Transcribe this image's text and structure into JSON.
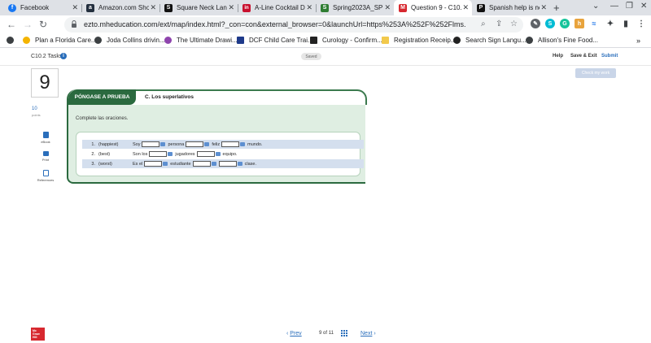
{
  "browser": {
    "tabs": [
      {
        "title": "Facebook",
        "icon": "facebook-icon",
        "color": "#1877f2",
        "glyph": "f"
      },
      {
        "title": "Amazon.com Sho",
        "icon": "amazon-icon",
        "color": "#232f3e",
        "glyph": "a"
      },
      {
        "title": "Square Neck Lant",
        "icon": "square-icon",
        "color": "#111111",
        "glyph": "S"
      },
      {
        "title": "A-Line Cocktail Dr",
        "icon": "linkedin-icon",
        "color": "#c8102e",
        "glyph": "in"
      },
      {
        "title": "Spring2023A_SPN",
        "icon": "syllabus-icon",
        "color": "#2e7d32",
        "glyph": "S"
      },
      {
        "title": "Question 9 - C10.2",
        "icon": "mheducation-icon",
        "color": "#d7282f",
        "glyph": "M"
      },
      {
        "title": "Spanish help is ne",
        "icon": "brainly-icon",
        "color": "#111111",
        "glyph": "P"
      }
    ],
    "active_tab": 5,
    "url": "ezto.mheducation.com/ext/map/index.html?_con=con&external_browser=0&launchUrl=https%253A%252F%252Flms.mheducatio...",
    "bookmarks": [
      {
        "label": "Plan a Florida Care..."
      },
      {
        "label": "Joda Collins drivin..."
      },
      {
        "label": "The Ultimate Drawi..."
      },
      {
        "label": "DCF Child Care Trai..."
      },
      {
        "label": "Curology - Confirm..."
      },
      {
        "label": "Registration Receip..."
      },
      {
        "label": "Search Sign Langu..."
      },
      {
        "label": "Allison's Fine Food..."
      }
    ],
    "bookmarks_more": "»"
  },
  "header": {
    "title": "C10.2 Tasks",
    "saved": "Saved",
    "help": "Help",
    "save_exit": "Save & Exit",
    "submit": "Submit"
  },
  "check_work": "Check my work",
  "question": {
    "number": "9",
    "points_value": "10",
    "points_label": "points",
    "tools": [
      {
        "label": "eBook",
        "icon": "ebook-icon"
      },
      {
        "label": "Print",
        "icon": "print-icon"
      },
      {
        "label": "References",
        "icon": "references-icon"
      }
    ]
  },
  "activity": {
    "tag": "PÓNGASE A PRUEBA",
    "section": "C. Los superlativos",
    "instructions": "Complete las oraciones.",
    "rows": [
      {
        "num": "1.",
        "hint": "(happiest)",
        "parts": [
          "Soy",
          "persona",
          "feliz",
          "mundo."
        ],
        "values": [
          "",
          "",
          ""
        ]
      },
      {
        "num": "2.",
        "hint": "(best)",
        "parts": [
          "Son los",
          "jugadores",
          "equipo."
        ],
        "values": [
          "",
          ""
        ]
      },
      {
        "num": "3.",
        "hint": "(worst)",
        "parts": [
          "Es el",
          "estudiante",
          "clase."
        ],
        "values": [
          "",
          "",
          ""
        ]
      }
    ]
  },
  "footer": {
    "logo_lines": [
      "Mc",
      "Graw",
      "Hill"
    ],
    "prev": "Prev",
    "page_current": "9",
    "page_of": "of",
    "page_total": "11",
    "next": "Next"
  }
}
